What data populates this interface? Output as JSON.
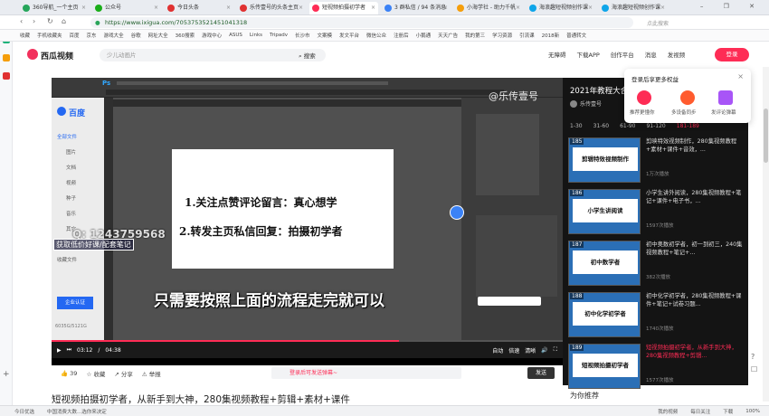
{
  "browser": {
    "tabs": [
      {
        "label": "360导航_一个主页",
        "color": "#26a65b",
        "active": false
      },
      {
        "label": "公众号",
        "color": "#1aad19",
        "active": false
      },
      {
        "label": "今日头条",
        "color": "#e03131",
        "active": false
      },
      {
        "label": "乐传壹号的头条主页",
        "color": "#e03131",
        "active": false
      },
      {
        "label": "短视频拍摄初学者",
        "color": "#fe2c55",
        "active": true
      },
      {
        "label": "3 群私信 / 94 条消息",
        "color": "#3b82f6",
        "active": false
      },
      {
        "label": "小海学社 - 助力千帆",
        "color": "#f59e0b",
        "active": false
      },
      {
        "label": "海浪趣短视频创作课",
        "color": "#0ea5e9",
        "active": false
      },
      {
        "label": "海浪趣短视频创作课",
        "color": "#0ea5e9",
        "active": false
      }
    ],
    "url": "https://www.ixigua.com/7053753521451041318",
    "url_search_hint": "点此搜索",
    "bookmarks": [
      "收藏",
      "手机收藏夹",
      "百度",
      "京东",
      "游戏大全",
      "谷歌",
      "网址大全",
      "360搜索",
      "游戏中心",
      "ASUS",
      "Links",
      "Tripadv",
      "长沙市",
      "文案模",
      "发文平台",
      "微信公众",
      "注册后",
      "小鹅通",
      "天天广告",
      "我的第三",
      "学习资源",
      "引流课",
      "2018新",
      "普通转文"
    ]
  },
  "site": {
    "logo_text": "西瓜视频",
    "search_placeholder": "少儿动画片",
    "search_btn": "搜索",
    "nav": [
      "无障碍",
      "下载APP",
      "创作平台",
      "消息",
      "发视频"
    ],
    "login": "登录"
  },
  "popup": {
    "title": "登录后享更多权益",
    "close": "×",
    "items": [
      {
        "label": "推荐更懂你",
        "color": "#fe2c55"
      },
      {
        "label": "多设备同步",
        "color": "#ff5b2e"
      },
      {
        "label": "发评论弹幕",
        "color": "#a855f7"
      }
    ]
  },
  "player": {
    "ps_watermark": "@乐传壹号",
    "overlay_left": "百度",
    "baidu_menu": [
      "全部文件",
      "图片",
      "文档",
      "视频",
      "种子",
      "音乐",
      "其它",
      "回收站",
      "收藏文件"
    ],
    "doc_lines": [
      "1.关注点赞评论留言：真心想学",
      "2.转发主页私信回复：拍摄初学者"
    ],
    "qq_watermark": "Q: 1243759568",
    "side_promo": "获取低价好课/配套笔记",
    "subtitle": "只需要按照上面的流程走完就可以",
    "time_current": "03:12",
    "time_total": "04:38",
    "progress_fraction": 0.68,
    "ctrl_items": [
      "自动",
      "倍速",
      "清晰"
    ],
    "user_badge": "企业认证",
    "storage": "6035G/5121G"
  },
  "actions": {
    "likes": "39",
    "fav": "收藏",
    "share": "分享",
    "report": "举报",
    "danmaku_hint": "登录后可发送弹幕~",
    "send": "发送"
  },
  "video_title": "短视频拍摄初学者，从新手到大神，280集视频教程+剪辑+素材+课件",
  "playlist": {
    "header": "2021年教程大合",
    "author": "乐传壹号",
    "tabs": [
      "1-30",
      "31-60",
      "61-90",
      "91-120",
      "181-189"
    ],
    "items": [
      {
        "num": "185",
        "thumb": "剪辑特效视频制作",
        "title": "剪映特效视频制作，280集视频教程+素材+课件+音效，...",
        "views": "1万次播放"
      },
      {
        "num": "186",
        "thumb": "小学生讲阅读",
        "title": "小学生讲外阅读，280集视频教程+笔记+课件+电子书，...",
        "views": "1597次播放"
      },
      {
        "num": "187",
        "thumb": "初中数学者",
        "title": "初中奥数初学者，初一到初三，240集视频教程+笔记+...",
        "views": "382次播放"
      },
      {
        "num": "188",
        "thumb": "初中化学初学者",
        "title": "初中化学初学者，280集视频教程+课件+笔记+试卷习题...",
        "views": "1740次播放"
      },
      {
        "num": "189",
        "thumb": "短视频拍摄初学者",
        "title": "短视频拍摄初学者，从新手到大神，280集视频教程+剪辑...",
        "views": "1577次播放",
        "active": true
      }
    ],
    "footer": "为你推荐"
  },
  "statusbar": {
    "left": [
      "今日优选",
      "中国消费大数...选你来决定"
    ],
    "right": [
      "我的视频",
      "每日关注",
      "下载",
      "100%"
    ]
  }
}
